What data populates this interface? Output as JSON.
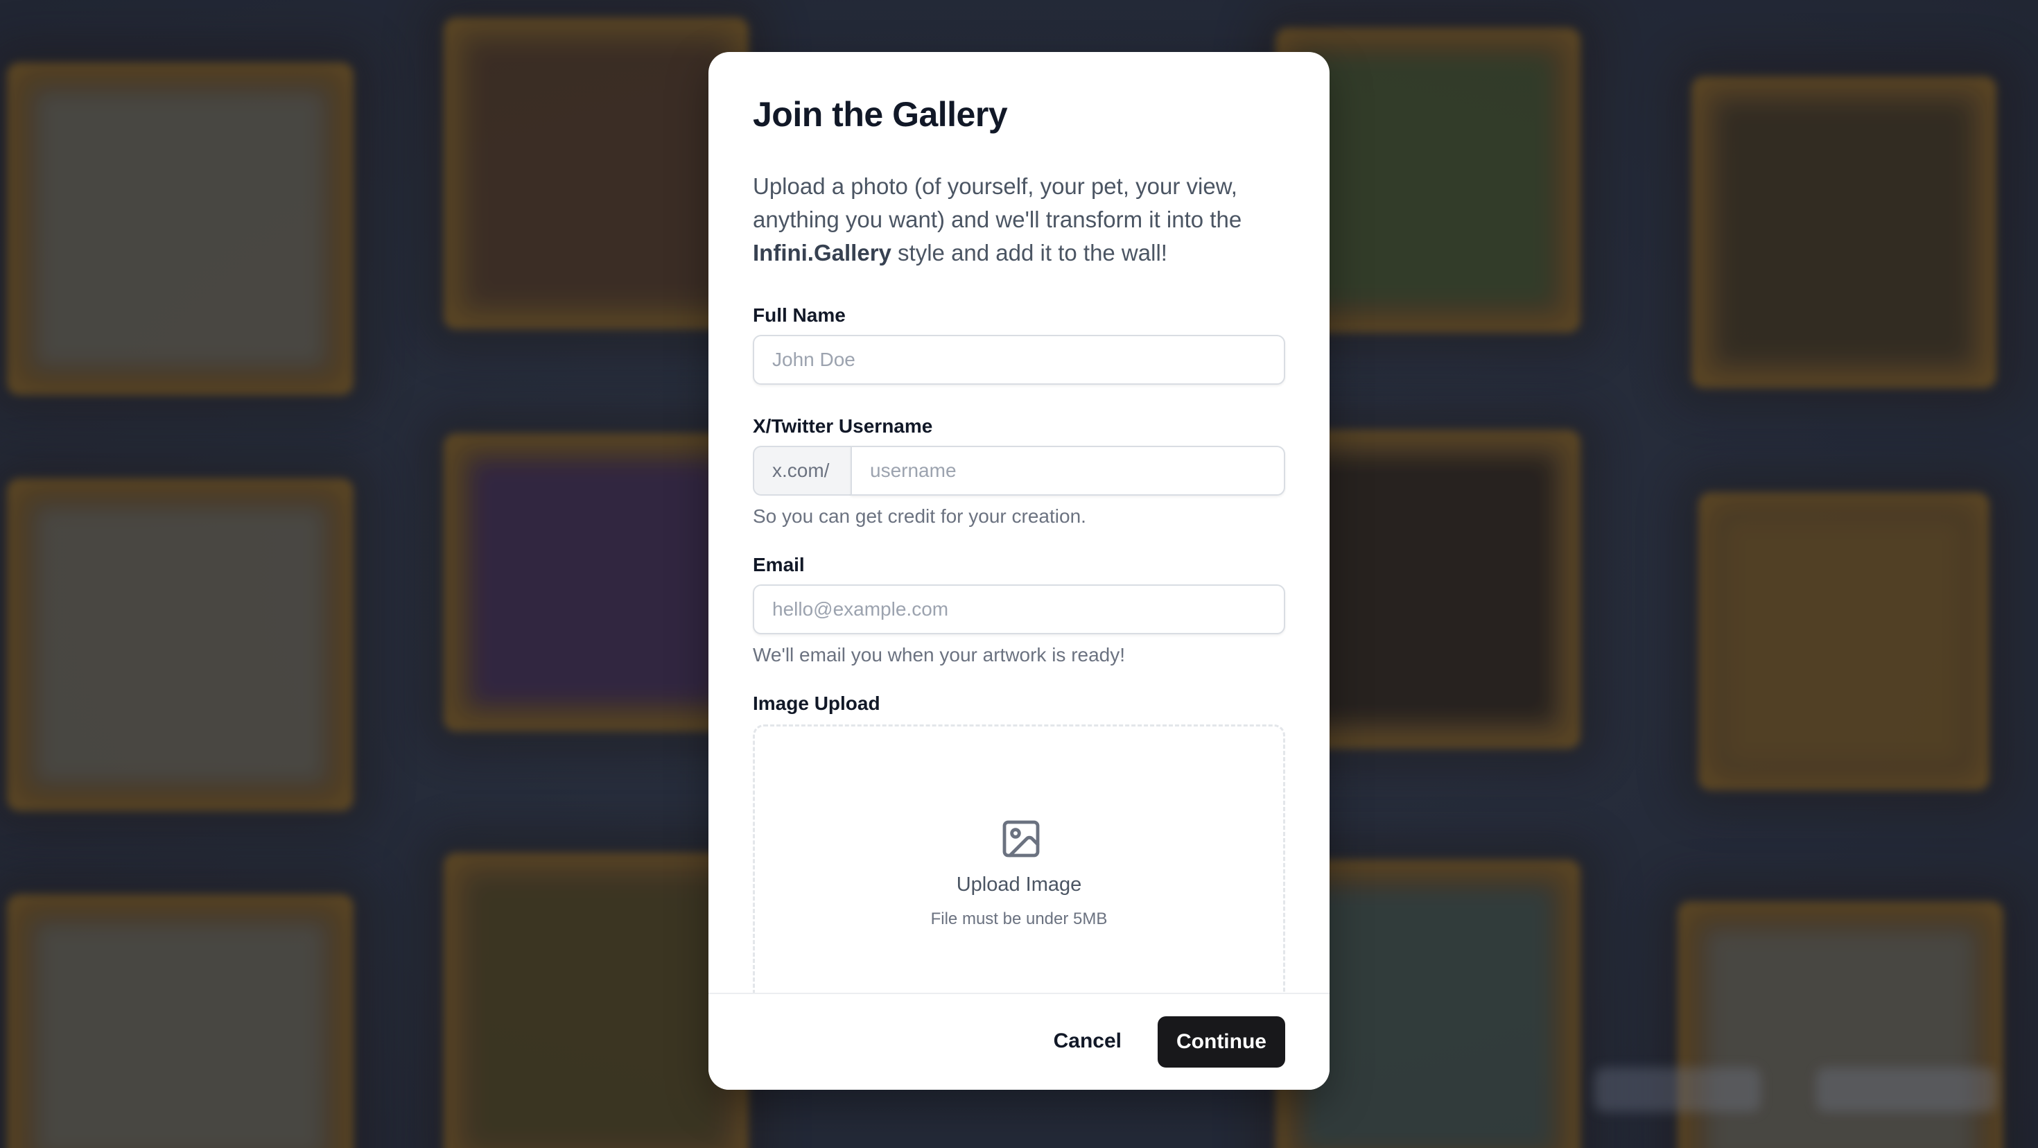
{
  "modal": {
    "title": "Join the Gallery",
    "intro_before": "Upload a photo (of yourself, your pet, your view, anything you want) and we'll transform it into the ",
    "intro_brand": "Infini.Gallery",
    "intro_after": " style and add it to the wall!",
    "full_name": {
      "label": "Full Name",
      "placeholder": "John Doe",
      "value": ""
    },
    "twitter": {
      "label": "X/Twitter Username",
      "prefix": "x.com/",
      "placeholder": "username",
      "value": "",
      "help": "So you can get credit for your creation."
    },
    "email": {
      "label": "Email",
      "placeholder": "hello@example.com",
      "value": "",
      "help": "We'll email you when your artwork is ready!"
    },
    "upload": {
      "label": "Image Upload",
      "icon": "image-icon",
      "title": "Upload Image",
      "subtitle": "File must be under 5MB"
    },
    "footer": {
      "cancel_label": "Cancel",
      "continue_label": "Continue"
    }
  },
  "colors": {
    "backdrop": "#2a3040",
    "frame_gold": "#7a5a22",
    "primary_button": "#18181b",
    "title_text": "#111827",
    "body_text": "#4b5563"
  }
}
